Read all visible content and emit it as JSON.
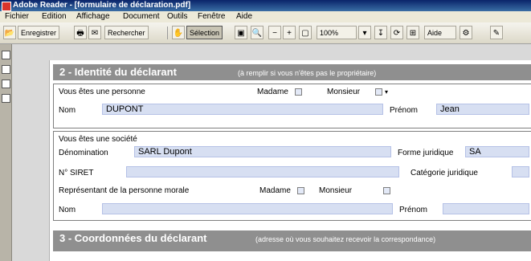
{
  "window": {
    "title": "Adobe Reader - [formulaire de déclaration.pdf]"
  },
  "menu": [
    "Fichier",
    "Edition",
    "Affichage",
    "Document",
    "Outils",
    "Fenêtre",
    "Aide"
  ],
  "toolbar": {
    "save_label": "Enregistrer",
    "search_label": "Rechercher",
    "select_label": "Sélection",
    "zoom_value": "100%",
    "help_label": "Aide"
  },
  "section2": {
    "title": "2 - Identité du déclarant",
    "subtitle": "(à remplir si vous n'êtes pas le propriétaire)",
    "individual": {
      "heading": "Vous êtes une personne",
      "madame_label": "Madame",
      "monsieur_label": "Monsieur",
      "nom_label": "Nom",
      "nom_value": "DUPONT",
      "prenom_label": "Prénom",
      "prenom_value": "Jean"
    },
    "company": {
      "heading": "Vous êtes une société",
      "denomination_label": "Dénomination",
      "denomination_value": "SARL Dupont",
      "forme_label": "Forme juridique",
      "forme_value": "SA",
      "siret_label": "N° SIRET",
      "siret_value": "",
      "categorie_label": "Catégorie juridique",
      "representant_label": "Représentant de la personne morale",
      "madame_label": "Madame",
      "monsieur_label": "Monsieur",
      "nom_label": "Nom",
      "prenom_label": "Prénom"
    }
  },
  "section3": {
    "title": "3 - Coordonnées du déclarant",
    "subtitle": "(adresse où vous souhaitez recevoir la correspondance)"
  }
}
